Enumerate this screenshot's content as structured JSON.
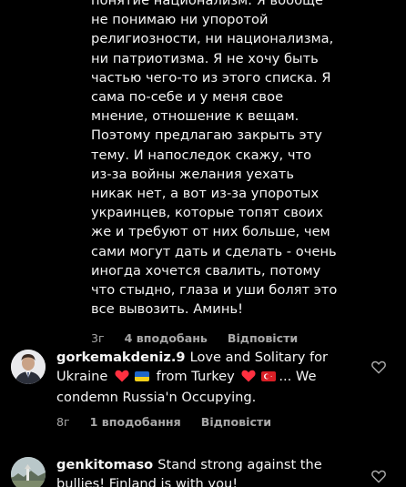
{
  "reply": {
    "text": "понятие национализм. Я вообще\nне понимаю ни упоротой\nрелигиозности, ни национализма,\nни патриотизма. Я не хочу быть\nчастью чего-то из этого списка. Я\nсама по-себе и у меня свое\nмнение, отношение к вещам.\nПоэтому предлагаю закрыть эту\nтему. И напоследок скажу, что\nиз-за войны желания уехать\nникак нет, а вот из-за упоротых\nукраинцев, которые топят своих\nже и требуют от них больше, чем\nсами могут дать и сделать - очень\nиногда хочется свалить, потому\nчто стыдно, глаза и уши болят это\nвсе вывозить. Аминь!",
    "time": "3г",
    "likes": "4 вподобань",
    "reply_label": "Відповісти"
  },
  "comments": [
    {
      "username": "gorkemakdeniz.9",
      "text_part1": "Love and Solitary for Ukraine",
      "text_part2": "from Turkey",
      "text_part3": "... We condemn Russia'n Occupying.",
      "time": "8г",
      "likes": "1 вподобання",
      "reply_label": "Відповісти",
      "avatar_icon": "person-avatar-icon",
      "heart_icon": "heart-outline-icon",
      "emoji": [
        "red-heart-icon",
        "ukraine-flag-icon",
        "red-heart-icon",
        "turkey-flag-icon"
      ]
    },
    {
      "username": "genkitomaso",
      "text": "Stand strong against the bullies! Finland is with you!",
      "avatar_icon": "landscape-avatar-icon",
      "heart_icon": "heart-outline-icon"
    }
  ],
  "colors": {
    "background": "#000000",
    "text": "#f5f5f5",
    "meta": "#a8a8a8",
    "heart_red": "#ff3040",
    "flag_blue": "#1d66c9",
    "flag_yellow": "#f2cf1a",
    "flag_turkey": "#d81f26"
  }
}
